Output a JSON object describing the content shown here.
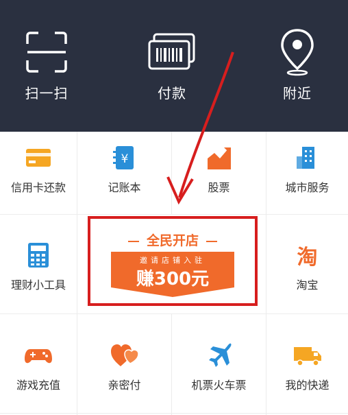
{
  "top_actions": [
    {
      "label": "扫一扫",
      "icon": "scan-icon"
    },
    {
      "label": "付款",
      "icon": "barcode-pay-icon"
    },
    {
      "label": "附近",
      "icon": "location-pin-icon"
    }
  ],
  "grid_row1": [
    {
      "label": "信用卡还款",
      "icon": "credit-card-icon",
      "color": "#f5a623"
    },
    {
      "label": "记账本",
      "icon": "ledger-icon",
      "color": "#2a8fd8"
    },
    {
      "label": "股票",
      "icon": "stock-chart-icon",
      "color": "#f06a2b"
    },
    {
      "label": "城市服务",
      "icon": "building-icon",
      "color": "#2a8fd8"
    }
  ],
  "grid_row2": [
    {
      "label": "理财小工具",
      "icon": "calculator-icon",
      "color": "#2a8fd8"
    },
    {
      "label": "淘宝",
      "icon": "taobao-icon",
      "color": "#f06a2b"
    }
  ],
  "grid_row3": [
    {
      "label": "游戏充值",
      "icon": "gamepad-icon",
      "color": "#f06a2b"
    },
    {
      "label": "亲密付",
      "icon": "hearts-icon",
      "color": "#f06a2b"
    },
    {
      "label": "机票火车票",
      "icon": "airplane-icon",
      "color": "#2a8fd8"
    },
    {
      "label": "我的快递",
      "icon": "delivery-truck-icon",
      "color": "#f5a623"
    }
  ],
  "promo": {
    "title": "全民开店",
    "subtitle": "邀请店铺入驻",
    "reward": "赚300元",
    "accent": "#f06a2b",
    "highlight_border": "#d71e1e"
  },
  "annotation": {
    "arrow_color": "#d71e1e"
  }
}
